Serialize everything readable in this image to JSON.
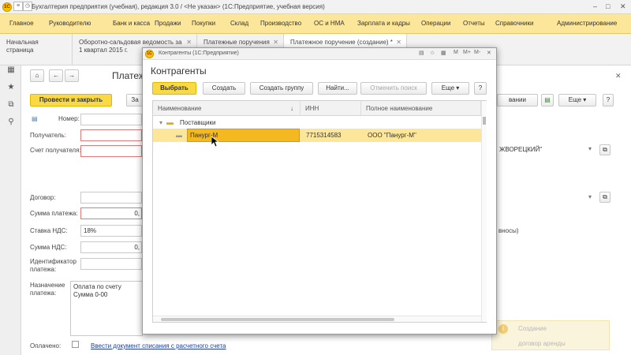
{
  "window": {
    "title": "Бухгалтерия предприятия (учебная), редакция 3.0 / <Не указан>  (1С:Предприятие, учебная версия)"
  },
  "sections": [
    "Главное",
    "Руководителю",
    "Банк и касса",
    "Продажи",
    "Покупки",
    "Склад",
    "Производство",
    "ОС и НМА",
    "Зарплата и кадры",
    "Операции",
    "Отчеты",
    "Справочники",
    "Администрирование"
  ],
  "tabs": [
    {
      "label": "Начальная страница"
    },
    {
      "label": "Оборотно-сальдовая ведомость за 1 квартал 2015 г."
    },
    {
      "label": "Платежные поручения"
    },
    {
      "label": "Платежное поручение (создание) *"
    }
  ],
  "form": {
    "title": "Платеж",
    "post_close": "Провести и закрыть",
    "btn_partial": "За",
    "labels": {
      "number": "Номер:",
      "recipient": "Получатель:",
      "recipient_account": "Счет получателя:",
      "contract": "Договор:",
      "amount": "Сумма платежа:",
      "vat_rate": "Ставка НДС:",
      "vat_amount": "Сумма НДС:",
      "payment_id": "Идентификатор платежа:",
      "purpose": "Назначение платежа:",
      "paid": "Оплачено:"
    },
    "values": {
      "amount": "0,",
      "vat_rate": "18%",
      "vat_amount": "0,",
      "purpose_line1": "Оплата по счету",
      "purpose_line2": "Сумма 0-00",
      "recipient_right": "ЖВОРЕЦКИЙ\"",
      "right_text": "вносы)",
      "right_btn": "вании",
      "more": "Еще"
    },
    "link_enter": "Ввести документ списания с расчетного счета"
  },
  "notification": {
    "line1": "Создание",
    "line2": "договор аренды"
  },
  "modal": {
    "title": "Контрагенты (1С:Предприятие)",
    "heading": "Контрагенты",
    "buttons": {
      "select": "Выбрать",
      "create": "Создать",
      "create_group": "Создать группу",
      "find": "Найти...",
      "cancel_search": "Отменить поиск",
      "more": "Еще",
      "help": "?"
    },
    "columns": [
      "Наименование",
      "ИНН",
      "Полное наименование"
    ],
    "group": "Поставщики",
    "rows": [
      {
        "name": "Панург-М",
        "inn": "7715314583",
        "full_name": "ООО \"Панург-М\""
      }
    ]
  }
}
